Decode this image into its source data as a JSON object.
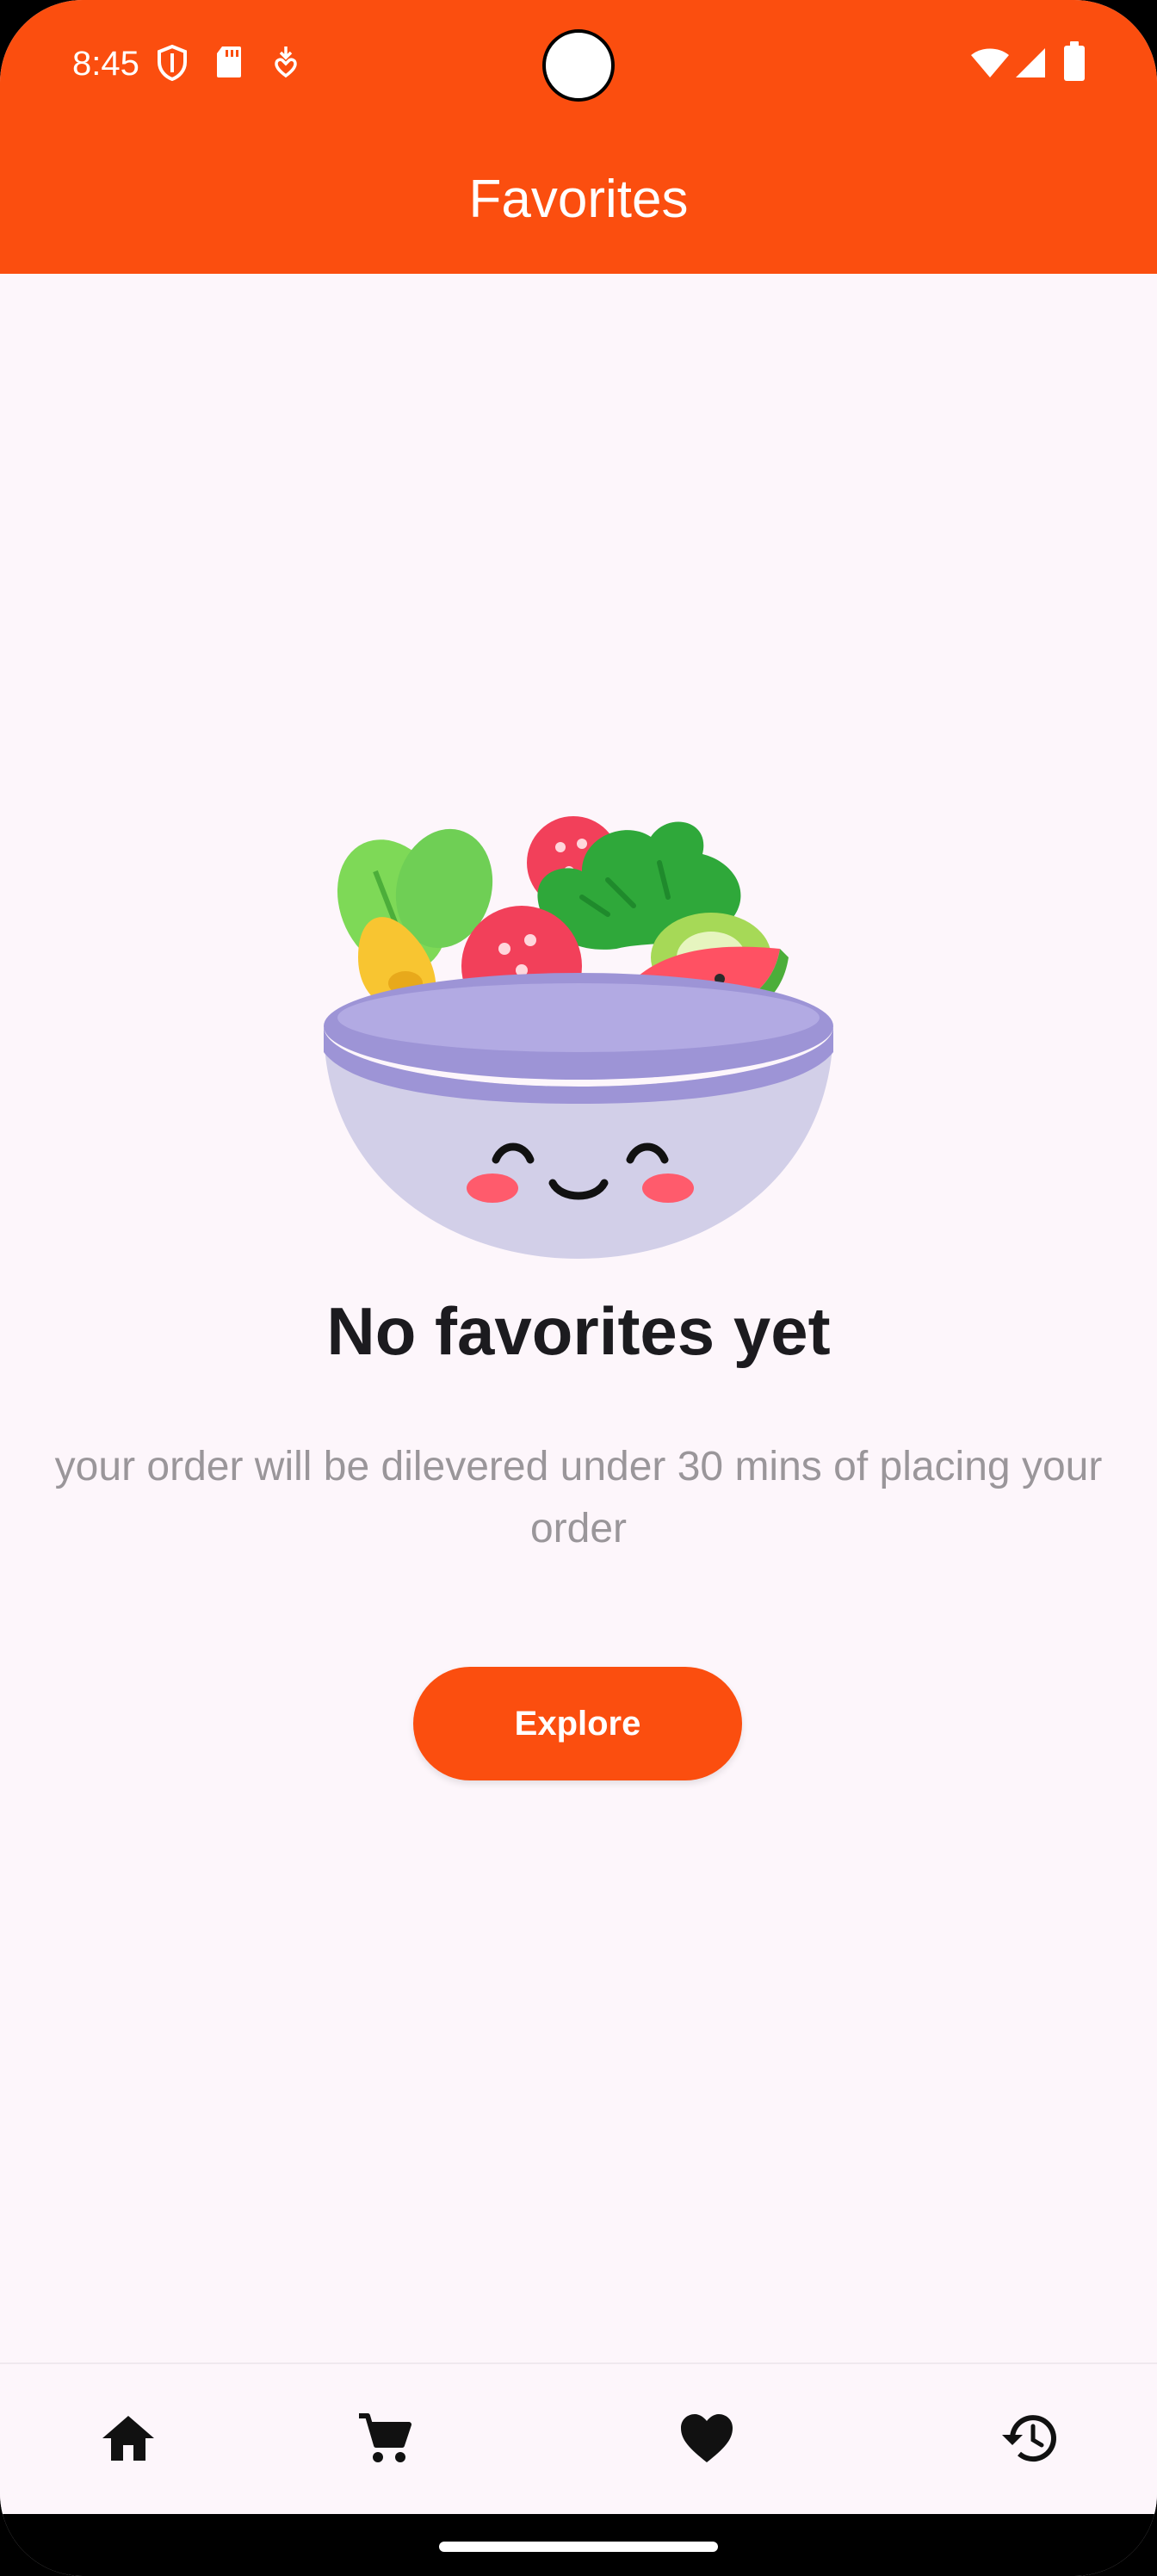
{
  "status_bar": {
    "time": "8:45",
    "left_icons": [
      "shield-icon",
      "sd-card-icon",
      "download-heart-icon"
    ],
    "right_icons": [
      "wifi-icon",
      "signal-icon",
      "battery-icon"
    ]
  },
  "app_bar": {
    "title": "Favorites",
    "color": "#fb4e0f"
  },
  "empty_state": {
    "illustration": "smiling-salad-bowl",
    "title": "No favorites yet",
    "subtitle": "your order will be dilevered under 30 mins of placing your order",
    "button_label": "Explore"
  },
  "bottom_nav": {
    "items": [
      {
        "icon": "home-icon"
      },
      {
        "icon": "cart-icon"
      },
      {
        "icon": "heart-icon"
      },
      {
        "icon": "history-icon"
      }
    ]
  }
}
